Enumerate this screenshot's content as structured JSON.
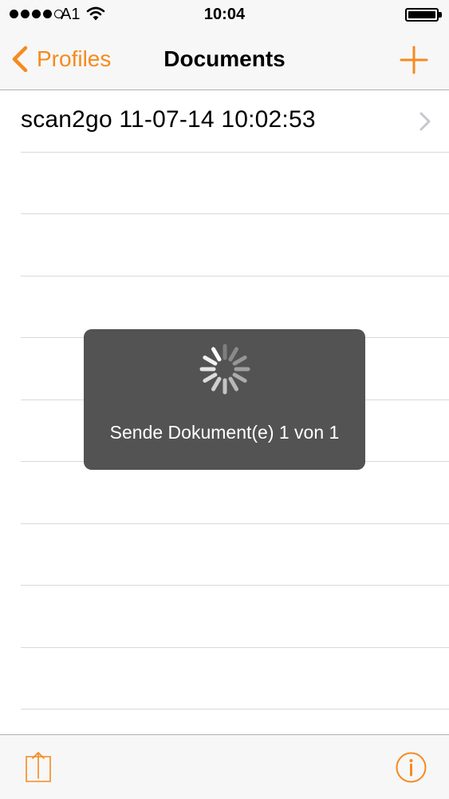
{
  "status_bar": {
    "carrier": "A1",
    "time": "10:04",
    "signal_bars_filled": 4,
    "signal_bars_total": 5,
    "icons": [
      "wifi-icon",
      "battery-icon"
    ]
  },
  "nav": {
    "back_label": "Profiles",
    "title": "Documents",
    "add_icon": "plus-icon"
  },
  "documents": [
    {
      "name": "scan2go 11-07-14 10:02:53"
    }
  ],
  "hud": {
    "message": "Sende Dokument(e) 1 von 1",
    "icon": "activity-spinner"
  },
  "toolbar": {
    "share_icon": "share-icon",
    "info_icon": "info-icon"
  },
  "colors": {
    "accent": "#f68a1e",
    "hud_background": "#535353",
    "bar_background": "#f7f7f7",
    "separator": "#d9d9d9"
  }
}
